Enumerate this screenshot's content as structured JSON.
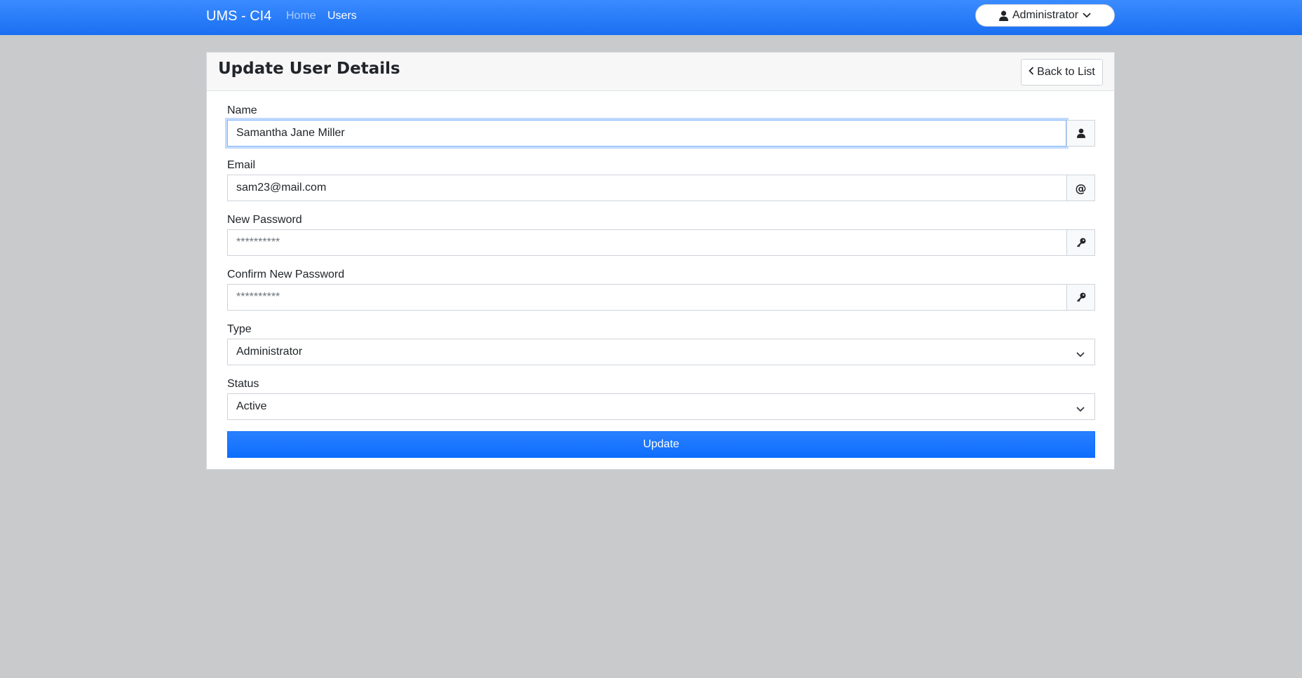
{
  "navbar": {
    "brand": "UMS - CI4",
    "links": [
      {
        "label": "Home",
        "active": false
      },
      {
        "label": "Users",
        "active": true
      }
    ],
    "user_menu": {
      "label": "Administrator",
      "icon": "user-icon",
      "caret": "chevron-down-icon"
    }
  },
  "card": {
    "title": "Update User Details",
    "back_button": {
      "label": "Back to List",
      "icon": "chevron-left-icon"
    }
  },
  "form": {
    "name": {
      "label": "Name",
      "value": "Samantha Jane Miller",
      "icon": "user-icon"
    },
    "email": {
      "label": "Email",
      "value": "sam23@mail.com",
      "icon": "at-icon",
      "icon_glyph": "@"
    },
    "new_password": {
      "label": "New Password",
      "placeholder": "**********",
      "icon": "key-icon"
    },
    "confirm_password": {
      "label": "Confirm New Password",
      "placeholder": "**********",
      "icon": "key-icon"
    },
    "type": {
      "label": "Type",
      "selected": "Administrator"
    },
    "status": {
      "label": "Status",
      "selected": "Active"
    },
    "submit_label": "Update"
  },
  "colors": {
    "navbar": "#1a6ff2",
    "primary_button": "#0d6efd",
    "page_background": "#c9cacc"
  }
}
